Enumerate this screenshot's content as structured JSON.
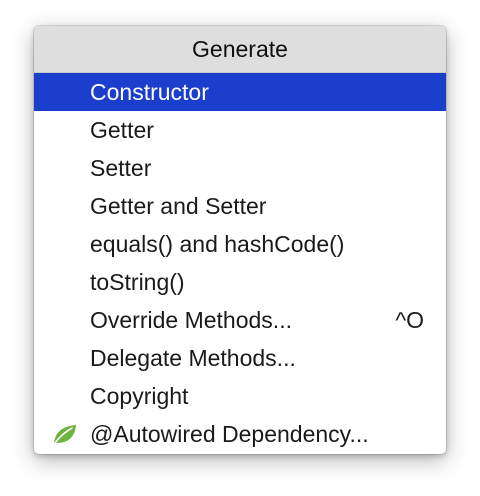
{
  "popup": {
    "title": "Generate",
    "items": [
      {
        "label": "Constructor",
        "shortcut": "",
        "selected": true
      },
      {
        "label": "Getter",
        "shortcut": ""
      },
      {
        "label": "Setter",
        "shortcut": ""
      },
      {
        "label": "Getter and Setter",
        "shortcut": ""
      },
      {
        "label": "equals() and hashCode()",
        "shortcut": ""
      },
      {
        "label": "toString()",
        "shortcut": ""
      },
      {
        "label": "Override Methods...",
        "shortcut": "^O"
      },
      {
        "label": "Delegate Methods...",
        "shortcut": ""
      },
      {
        "label": "Copyright",
        "shortcut": ""
      },
      {
        "label": "@Autowired Dependency...",
        "shortcut": "",
        "icon": "spring-leaf-icon"
      }
    ]
  },
  "colors": {
    "selection": "#1b3fcc",
    "header_bg": "#dedede",
    "leaf_icon": "#6db33f"
  }
}
